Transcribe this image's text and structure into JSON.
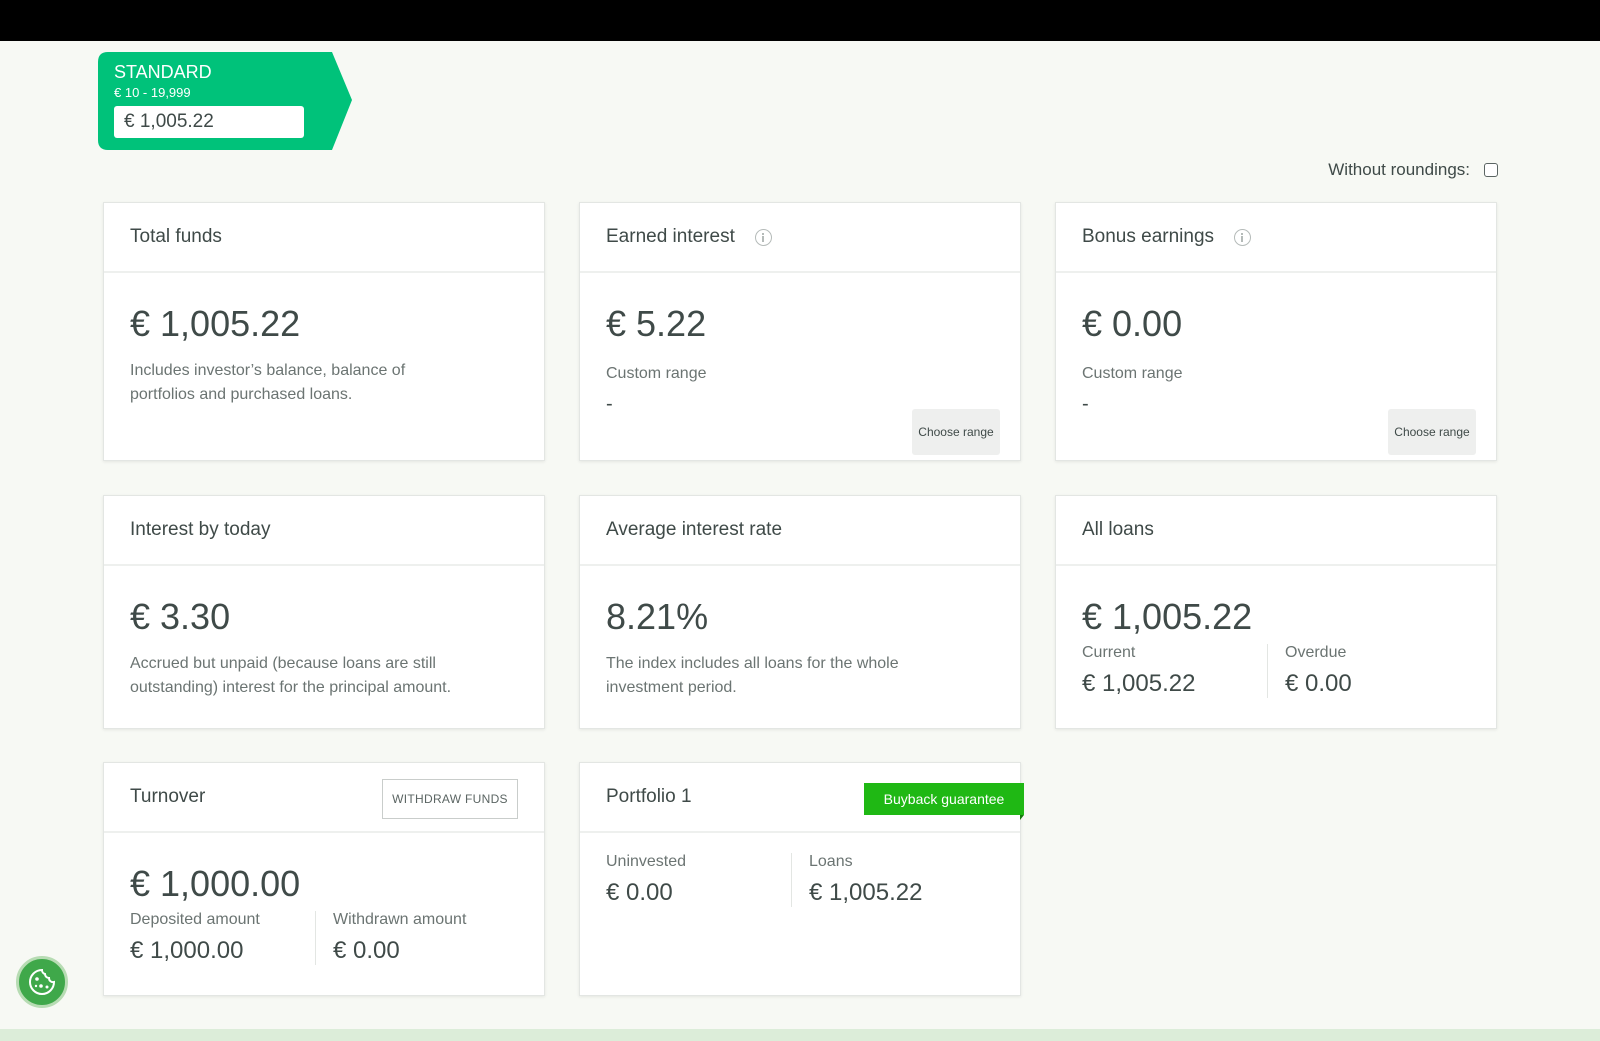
{
  "level": {
    "name": "STANDARD",
    "range": "€ 10 - 19,999",
    "amount": "€ 1,005.22",
    "color": "#00c27a"
  },
  "roundings": {
    "label": "Without roundings:",
    "checked": false
  },
  "cards": {
    "total_funds": {
      "title": "Total funds",
      "value": "€ 1,005.22",
      "desc": "Includes investor’s balance, balance of portfolios and purchased loans."
    },
    "earned_interest": {
      "title": "Earned interest",
      "value": "€ 5.22",
      "range_label": "Custom range",
      "range_value": "-",
      "button": "Choose range"
    },
    "bonus_earnings": {
      "title": "Bonus earnings",
      "value": "€ 0.00",
      "range_label": "Custom range",
      "range_value": "-",
      "button": "Choose range"
    },
    "interest_today": {
      "title": "Interest by today",
      "value": "€ 3.30",
      "desc": "Accrued but unpaid (because loans are still outstanding) interest for the principal amount."
    },
    "avg_rate": {
      "title": "Average interest rate",
      "value": "8.21%",
      "desc": "The index includes all loans for the whole investment period."
    },
    "all_loans": {
      "title": "All loans",
      "value": "€ 1,005.22",
      "current_label": "Current",
      "current_value": "€ 1,005.22",
      "overdue_label": "Overdue",
      "overdue_value": "€ 0.00"
    },
    "turnover": {
      "title": "Turnover",
      "button": "WITHDRAW FUNDS",
      "value": "€ 1,000.00",
      "deposited_label": "Deposited amount",
      "deposited_value": "€ 1,000.00",
      "withdrawn_label": "Withdrawn amount",
      "withdrawn_value": "€ 0.00"
    },
    "portfolio": {
      "title": "Portfolio 1",
      "badge": "Buyback guarantee",
      "uninvested_label": "Uninvested",
      "uninvested_value": "€ 0.00",
      "loans_label": "Loans",
      "loans_value": "€ 1,005.22"
    }
  },
  "colors": {
    "accent_green": "#00c27a",
    "buyback_green": "#1fb814",
    "text": "#3f4a48"
  }
}
